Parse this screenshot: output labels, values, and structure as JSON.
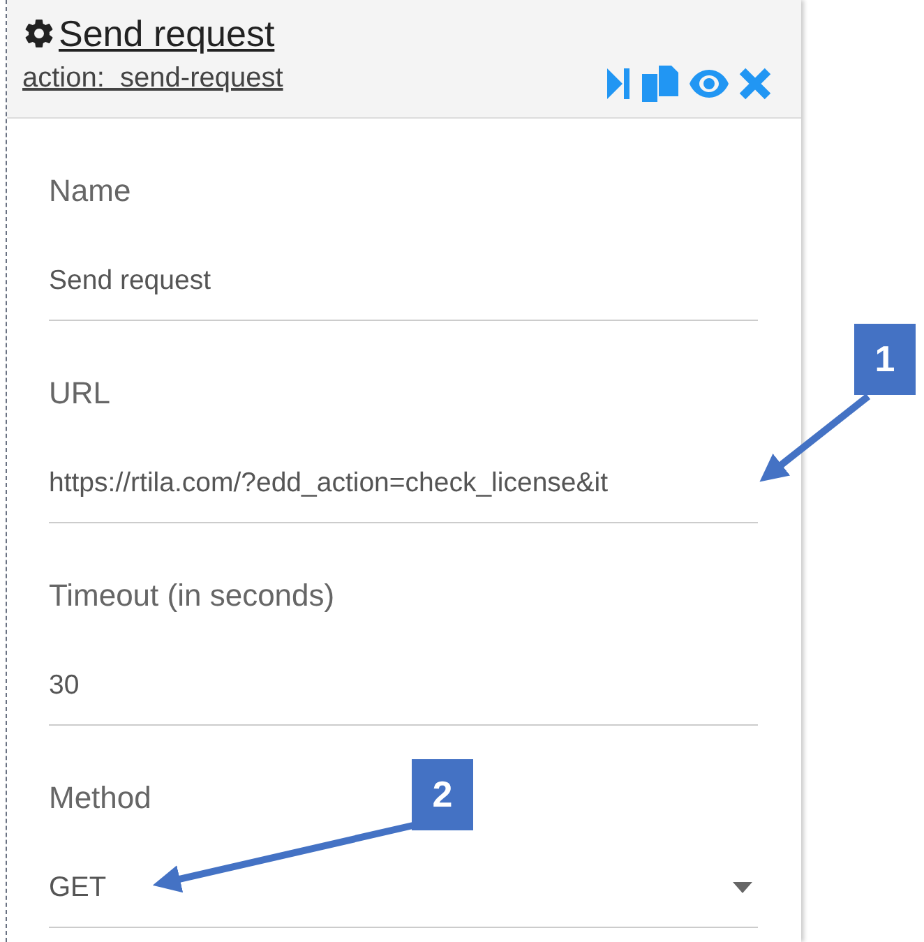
{
  "panel": {
    "title": "Send request",
    "subtitle": "action:  send-request"
  },
  "fields": [
    {
      "kind": "text",
      "label": "Name",
      "value": "Send request"
    },
    {
      "kind": "text",
      "label": "URL",
      "value": "https://rtila.com/?edd_action=check_license&it"
    },
    {
      "kind": "text",
      "label": "Timeout (in seconds)",
      "value": "30"
    },
    {
      "kind": "select",
      "label": "Method",
      "value": "GET"
    }
  ],
  "annotations": [
    {
      "label": "1"
    },
    {
      "label": "2"
    }
  ]
}
